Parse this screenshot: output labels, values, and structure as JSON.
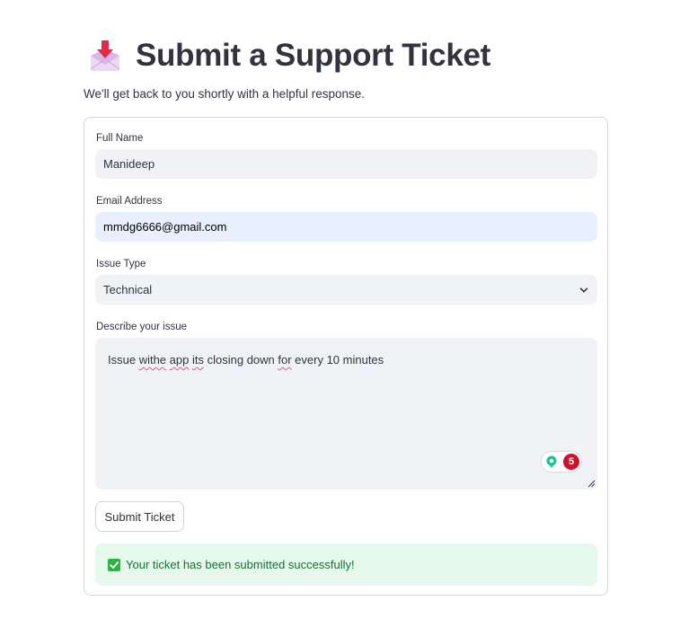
{
  "header": {
    "icon": "inbox-tray-icon",
    "title": "Submit a Support Ticket",
    "subtitle": "We'll get back to you shortly with a helpful response."
  },
  "form": {
    "full_name": {
      "label": "Full Name",
      "value": "Manideep"
    },
    "email": {
      "label": "Email Address",
      "value": "mmdg6666@gmail.com"
    },
    "issue_type": {
      "label": "Issue Type",
      "selected": "Technical",
      "icon": "chevron-down-icon"
    },
    "description": {
      "label": "Describe your issue",
      "segments": [
        "Issue ",
        "withe",
        " ",
        "app",
        " ",
        "its",
        " closing down ",
        "for",
        " every 10 minutes"
      ],
      "misspelled_segments": [
        "withe",
        "app",
        "its",
        "for"
      ]
    },
    "grammarly": {
      "icon": "grammarly-icon",
      "count": "5"
    },
    "submit_label": "Submit Ticket"
  },
  "alert": {
    "icon": "check-box-icon",
    "message": "Your ticket has been submitted successfully!"
  },
  "colors": {
    "text": "#31333f",
    "input_bg": "#f0f2f6",
    "autofill_bg": "#e8f0fe",
    "success_bg": "#e6f7ec",
    "success_text": "#177233",
    "spell_underline": "#e0557a",
    "grammarly_badge": "#d0112b",
    "grammarly_logo": "#15c39a"
  }
}
